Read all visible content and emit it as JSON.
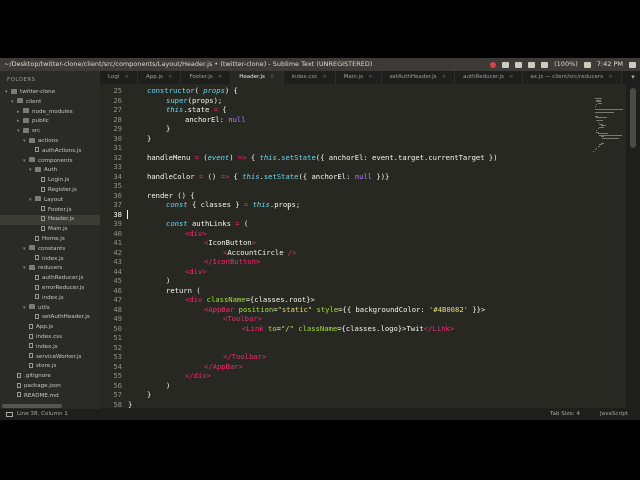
{
  "window": {
    "title": "~/Desktop/twitter-clone/client/src/components/Layout/Header.js • (twitter-clone) - Sublime Text (UNREGISTERED)",
    "tray": {
      "battery": "(100%)",
      "clock": "7:42 PM"
    }
  },
  "sidebar": {
    "header": "FOLDERS",
    "items": [
      {
        "label": "twitter-clone",
        "kind": "folder",
        "open": true
      },
      {
        "label": "client",
        "kind": "folder",
        "open": true
      },
      {
        "label": "node_modules",
        "kind": "folder",
        "open": false
      },
      {
        "label": "public",
        "kind": "folder",
        "open": false
      },
      {
        "label": "src",
        "kind": "folder",
        "open": true
      },
      {
        "label": "actions",
        "kind": "folder",
        "open": true
      },
      {
        "label": "authActions.js",
        "kind": "file"
      },
      {
        "label": "components",
        "kind": "folder",
        "open": true
      },
      {
        "label": "Auth",
        "kind": "folder",
        "open": true
      },
      {
        "label": "Login.js",
        "kind": "file"
      },
      {
        "label": "Register.js",
        "kind": "file"
      },
      {
        "label": "Layout",
        "kind": "folder",
        "open": true
      },
      {
        "label": "Footer.js",
        "kind": "file"
      },
      {
        "label": "Header.js",
        "kind": "file",
        "selected": true
      },
      {
        "label": "Main.js",
        "kind": "file"
      },
      {
        "label": "Home.js",
        "kind": "file"
      },
      {
        "label": "constants",
        "kind": "folder",
        "open": true
      },
      {
        "label": "index.js",
        "kind": "file"
      },
      {
        "label": "reducers",
        "kind": "folder",
        "open": true
      },
      {
        "label": "authReducer.js",
        "kind": "file"
      },
      {
        "label": "errorReducer.js",
        "kind": "file"
      },
      {
        "label": "index.js",
        "kind": "file"
      },
      {
        "label": "utils",
        "kind": "folder",
        "open": true
      },
      {
        "label": "setAuthHeader.js",
        "kind": "file"
      },
      {
        "label": "App.js",
        "kind": "file"
      },
      {
        "label": "index.css",
        "kind": "file"
      },
      {
        "label": "index.js",
        "kind": "file"
      },
      {
        "label": "serviceWorker.js",
        "kind": "file"
      },
      {
        "label": "store.js",
        "kind": "file"
      },
      {
        "label": ".gitignore",
        "kind": "file"
      },
      {
        "label": "package.json",
        "kind": "file"
      },
      {
        "label": "README.md",
        "kind": "file"
      }
    ]
  },
  "tabs": [
    {
      "label": "Logi",
      "active": false
    },
    {
      "label": "App.js",
      "active": false
    },
    {
      "label": "Footer.js",
      "active": false
    },
    {
      "label": "Header.js",
      "active": true
    },
    {
      "label": "index.css",
      "active": false
    },
    {
      "label": "Main.js",
      "active": false
    },
    {
      "label": "setAuthHeader.js",
      "active": false
    },
    {
      "label": "authReducer.js",
      "active": false
    },
    {
      "label": "ex.js — client/src/reducers",
      "active": false
    }
  ],
  "editor": {
    "current_line": 38,
    "lines": [
      {
        "n": 25,
        "indent": 1,
        "tokens": [
          [
            "fn",
            "constructor"
          ],
          [
            "",
            "( "
          ],
          [
            "kw",
            "props"
          ],
          [
            "",
            ") {"
          ]
        ]
      },
      {
        "n": 26,
        "indent": 2,
        "tokens": [
          [
            "fn",
            "super"
          ],
          [
            "",
            "(props);"
          ]
        ]
      },
      {
        "n": 27,
        "indent": 2,
        "tokens": [
          [
            "kw",
            "this"
          ],
          [
            "",
            ".state "
          ],
          [
            "st",
            "="
          ],
          [
            "",
            " {"
          ]
        ]
      },
      {
        "n": 28,
        "indent": 3,
        "tokens": [
          [
            "",
            "anchorEl: "
          ],
          [
            "num",
            "null"
          ]
        ]
      },
      {
        "n": 29,
        "indent": 2,
        "tokens": [
          [
            "",
            "}"
          ]
        ]
      },
      {
        "n": 30,
        "indent": 1,
        "tokens": [
          [
            "",
            "}"
          ]
        ]
      },
      {
        "n": 31,
        "indent": 0,
        "tokens": []
      },
      {
        "n": 32,
        "indent": 1,
        "tokens": [
          [
            "",
            "handleMenu "
          ],
          [
            "st",
            "="
          ],
          [
            "",
            " ("
          ],
          [
            "kw",
            "event"
          ],
          [
            "",
            ") "
          ],
          [
            "st",
            "=>"
          ],
          [
            "",
            " { "
          ],
          [
            "kw",
            "this"
          ],
          [
            "",
            "."
          ],
          [
            "fn",
            "setState"
          ],
          [
            "",
            "({ anchorEl: event.target.currentTarget })"
          ]
        ]
      },
      {
        "n": 33,
        "indent": 0,
        "tokens": []
      },
      {
        "n": 34,
        "indent": 1,
        "tokens": [
          [
            "",
            "handleColor "
          ],
          [
            "st",
            "="
          ],
          [
            "",
            " () "
          ],
          [
            "st",
            "=>"
          ],
          [
            "",
            " { "
          ],
          [
            "kw",
            "this"
          ],
          [
            "",
            "."
          ],
          [
            "fn",
            "setState"
          ],
          [
            "",
            "({ anchorEl: "
          ],
          [
            "num",
            "null"
          ],
          [
            "",
            " })}"
          ]
        ]
      },
      {
        "n": 35,
        "indent": 0,
        "tokens": []
      },
      {
        "n": 36,
        "indent": 1,
        "tokens": [
          [
            "",
            "render () {"
          ]
        ]
      },
      {
        "n": 37,
        "indent": 2,
        "tokens": [
          [
            "kw",
            "const"
          ],
          [
            "",
            " { classes } "
          ],
          [
            "st",
            "="
          ],
          [
            "",
            " "
          ],
          [
            "kw",
            "this"
          ],
          [
            "",
            ".props;"
          ]
        ]
      },
      {
        "n": 38,
        "indent": 0,
        "tokens": []
      },
      {
        "n": 39,
        "indent": 2,
        "tokens": [
          [
            "kw",
            "const"
          ],
          [
            "",
            " authLinks "
          ],
          [
            "st",
            "="
          ],
          [
            "",
            " ("
          ]
        ]
      },
      {
        "n": 40,
        "indent": 3,
        "tokens": [
          [
            "tg",
            "<div>"
          ]
        ]
      },
      {
        "n": 41,
        "indent": 4,
        "tokens": [
          [
            "tg",
            "<"
          ],
          [
            "",
            "IconButton"
          ],
          [
            "tg",
            ">"
          ]
        ]
      },
      {
        "n": 42,
        "indent": 5,
        "tokens": [
          [
            "tg",
            "<"
          ],
          [
            "",
            "AccountCircle "
          ],
          [
            "tg",
            "/>"
          ]
        ]
      },
      {
        "n": 43,
        "indent": 4,
        "tokens": [
          [
            "tg",
            "</IconButton>"
          ]
        ]
      },
      {
        "n": 44,
        "indent": 3,
        "tokens": [
          [
            "tg",
            "<div>"
          ]
        ]
      },
      {
        "n": 45,
        "indent": 2,
        "tokens": [
          [
            "",
            ")"
          ]
        ]
      },
      {
        "n": 46,
        "indent": 2,
        "tokens": [
          [
            "",
            "return ("
          ]
        ]
      },
      {
        "n": 47,
        "indent": 3,
        "tokens": [
          [
            "tg",
            "<div "
          ],
          [
            "at",
            "className"
          ],
          [
            "",
            "={classes.root}>"
          ]
        ]
      },
      {
        "n": 48,
        "indent": 4,
        "tokens": [
          [
            "tg",
            "<AppBar "
          ],
          [
            "at",
            "position"
          ],
          [
            "",
            "="
          ],
          [
            "str",
            "\"static\""
          ],
          [
            "",
            " "
          ],
          [
            "at",
            "style"
          ],
          [
            "",
            "={{ backgroundColor: "
          ],
          [
            "str",
            "'#4B0082'"
          ],
          [
            "",
            " }}>"
          ]
        ]
      },
      {
        "n": 49,
        "indent": 5,
        "tokens": [
          [
            "tg",
            "<Toolbar>"
          ]
        ]
      },
      {
        "n": 50,
        "indent": 6,
        "tokens": [
          [
            "tg",
            "<Link "
          ],
          [
            "at",
            "to"
          ],
          [
            "",
            "="
          ],
          [
            "str",
            "\"/\""
          ],
          [
            "",
            " "
          ],
          [
            "at",
            "className"
          ],
          [
            "",
            "={classes.logo}>Twit"
          ],
          [
            "tg",
            "</Link>"
          ]
        ]
      },
      {
        "n": 51,
        "indent": 0,
        "tokens": []
      },
      {
        "n": 52,
        "indent": 0,
        "tokens": []
      },
      {
        "n": 53,
        "indent": 5,
        "tokens": [
          [
            "tg",
            "</Toolbar>"
          ]
        ]
      },
      {
        "n": 54,
        "indent": 4,
        "tokens": [
          [
            "tg",
            "</AppBar>"
          ]
        ]
      },
      {
        "n": 55,
        "indent": 3,
        "tokens": [
          [
            "tg",
            "</div>"
          ]
        ]
      },
      {
        "n": 56,
        "indent": 2,
        "tokens": [
          [
            "",
            ")"
          ]
        ]
      },
      {
        "n": 57,
        "indent": 1,
        "tokens": [
          [
            "",
            "}"
          ]
        ]
      },
      {
        "n": 58,
        "indent": 0,
        "tokens": [
          [
            "",
            "}"
          ]
        ]
      }
    ]
  },
  "statusbar": {
    "position": "Line 38, Column 1",
    "tab_size": "Tab Size: 4",
    "syntax": "JavaScript"
  },
  "colors": {
    "editor_bg": "#272822",
    "sidebar_bg": "#2a2b26",
    "keyword": "#66d9ef",
    "operator": "#f92672",
    "attribute": "#a6e22e",
    "string": "#e6db74",
    "number": "#ae81ff"
  }
}
